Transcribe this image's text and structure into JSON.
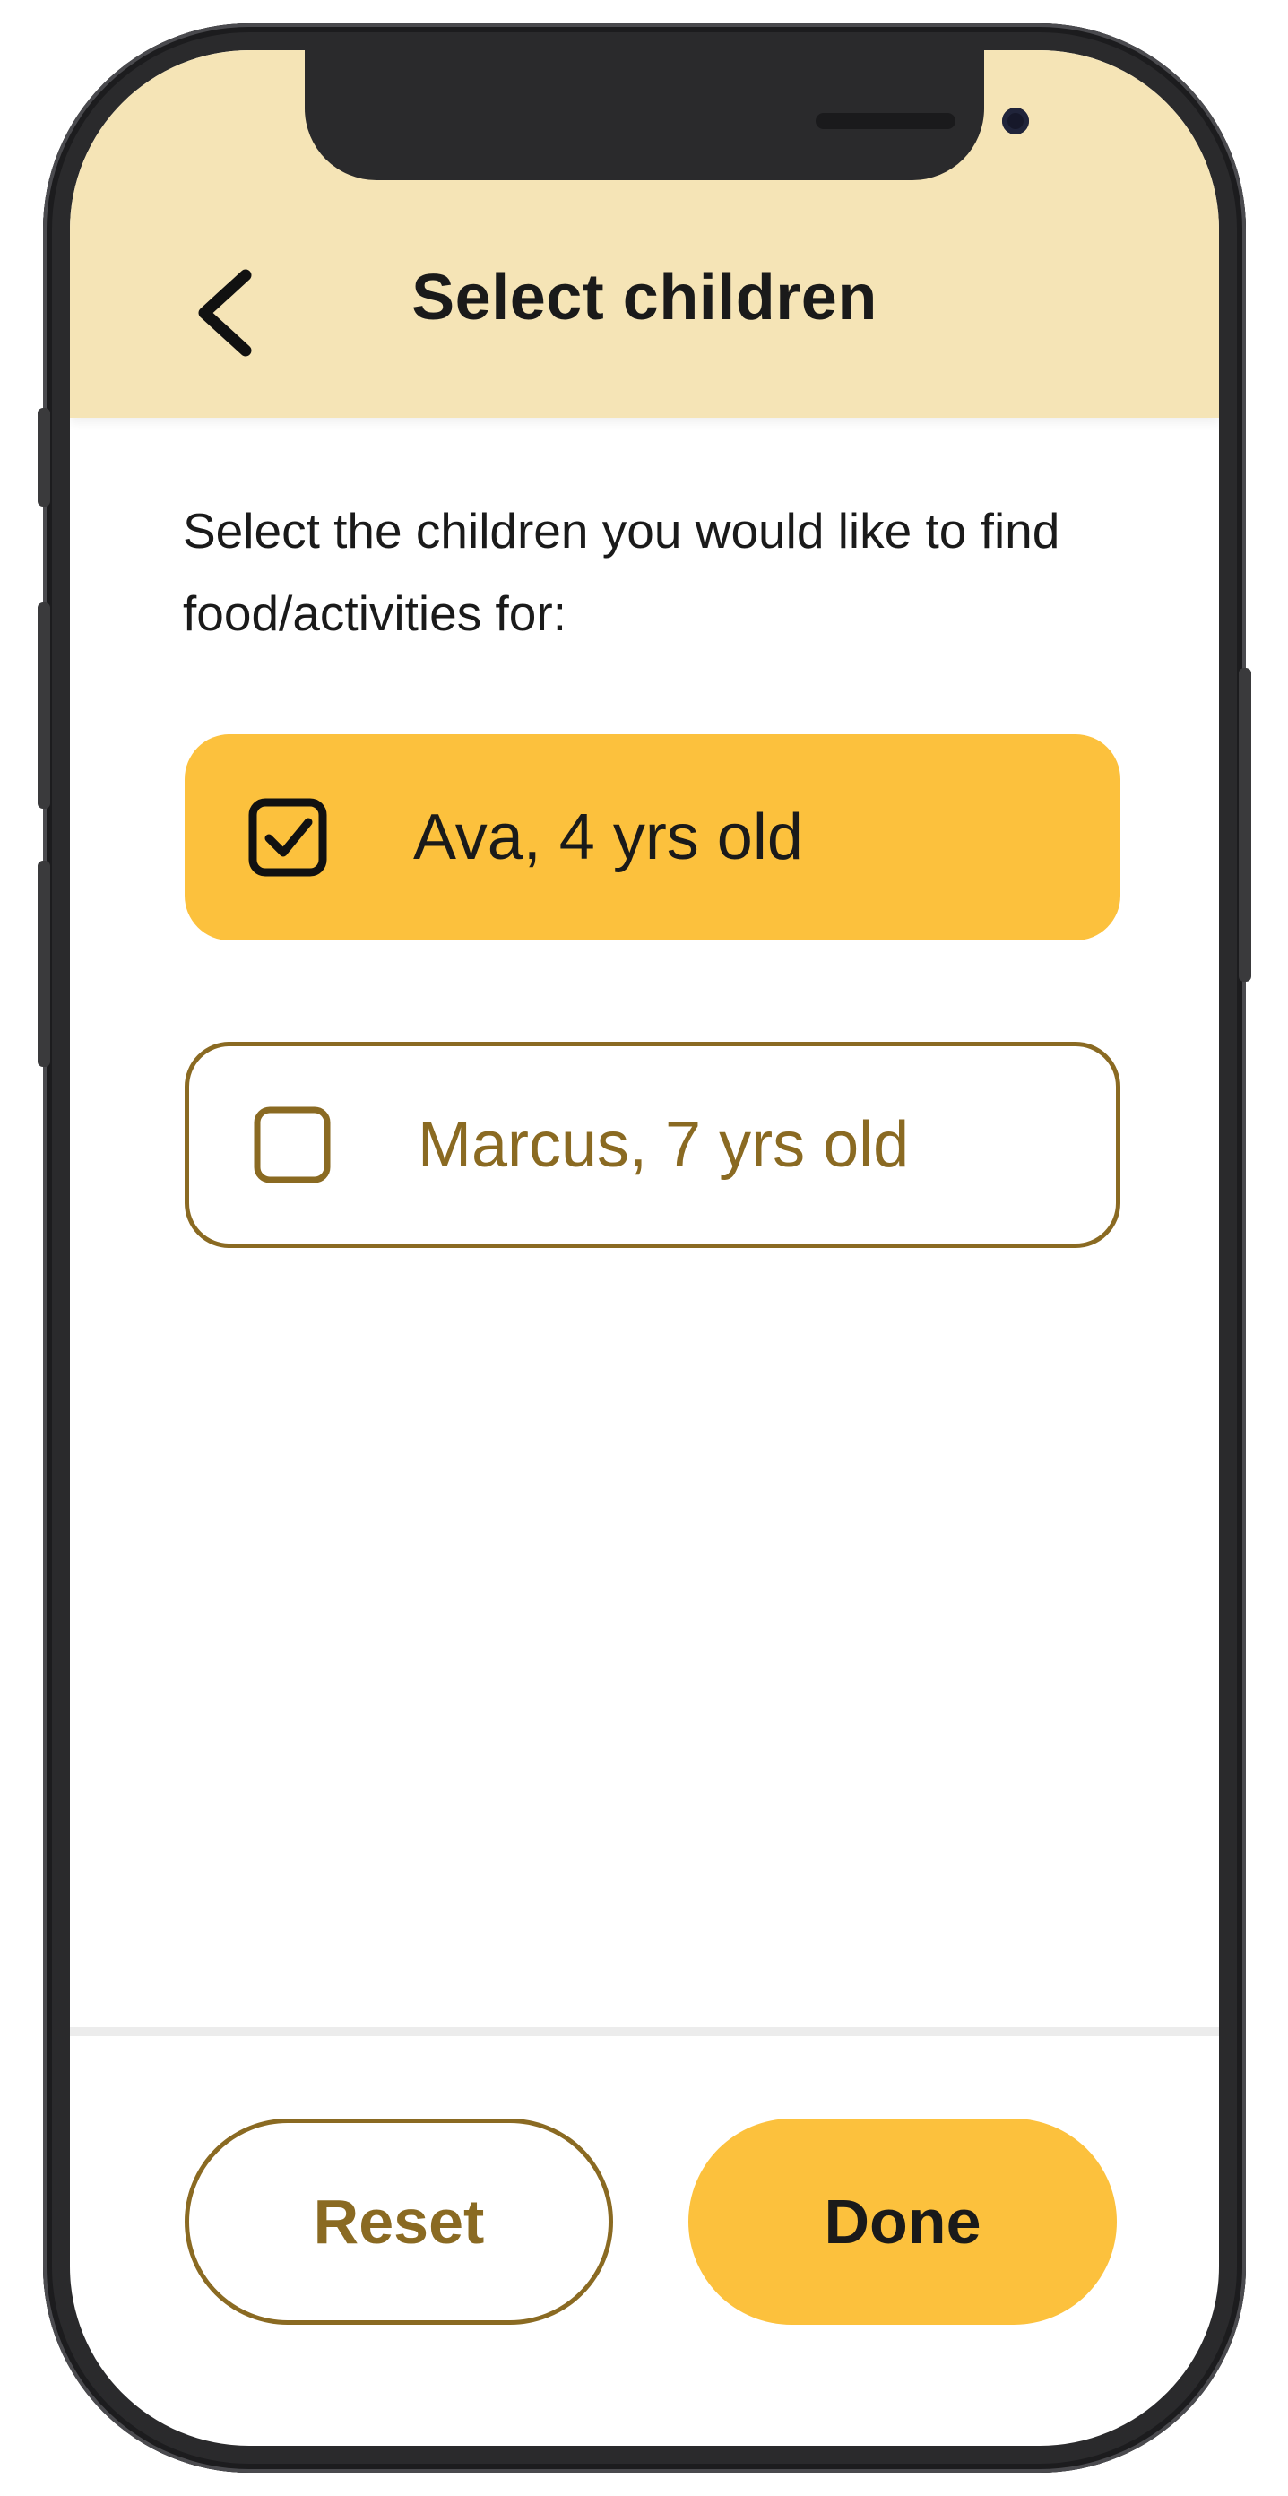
{
  "header": {
    "title": "Select children",
    "back_icon": "chevron-left-icon"
  },
  "prompt": {
    "text": "Select the children you would like to find food/activities for:"
  },
  "children": [
    {
      "label": "Ava, 4 yrs old",
      "checked": true
    },
    {
      "label": "Marcus, 7 yrs old",
      "checked": false
    }
  ],
  "footer": {
    "reset_label": "Reset",
    "done_label": "Done"
  },
  "colors": {
    "header_bg": "#f5e4b6",
    "accent": "#fcc13d",
    "outline": "#8a6a22",
    "text": "#1a1a1a"
  }
}
